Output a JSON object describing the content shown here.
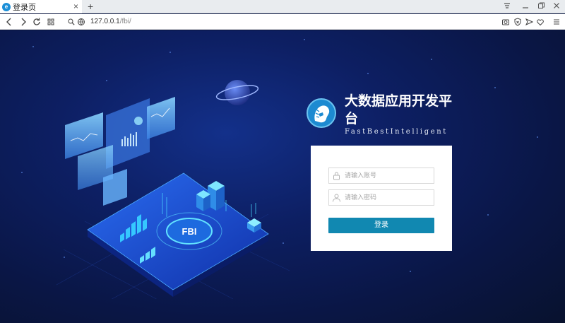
{
  "browser": {
    "tab_title": "登录页",
    "tab_close": "×",
    "new_tab": "+",
    "url_host": "127.0.0.1",
    "url_path": "/fbi/"
  },
  "brand": {
    "title": "大数据应用开发平台",
    "subtitle": "FastBestIntelligent"
  },
  "illustration": {
    "center_label": "FBI"
  },
  "login": {
    "username_placeholder": "请输入账号",
    "password_placeholder": "请输入密码",
    "submit_label": "登录"
  },
  "colors": {
    "accent": "#1188b1",
    "page_bg": "#0a1640"
  }
}
